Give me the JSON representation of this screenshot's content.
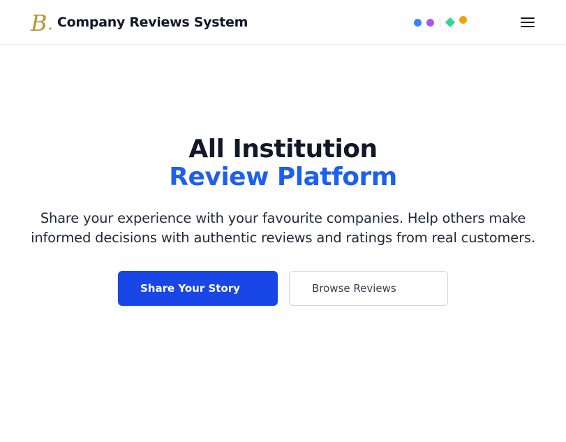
{
  "header": {
    "brand_title": "Company Reviews System",
    "logo_letter": "B",
    "logo_color": "#b8922e",
    "indicator_colors": {
      "blue": "#3b82f6",
      "purple": "#a855f7",
      "green": "#34d399",
      "orange": "#f59e0b"
    },
    "menu_icon": "hamburger-menu-icon"
  },
  "hero": {
    "title_line1": "All Institution",
    "title_line2": "Review Platform",
    "title_accent_color": "#1d5ff0",
    "subtitle_line1": "Share your experience with your favourite companies. Help others make",
    "subtitle_line2": "informed decisions with authentic reviews and ratings from real customers.",
    "primary_button": "Share Your Story",
    "primary_button_color": "#1946e6",
    "secondary_button": "Browse Reviews"
  }
}
